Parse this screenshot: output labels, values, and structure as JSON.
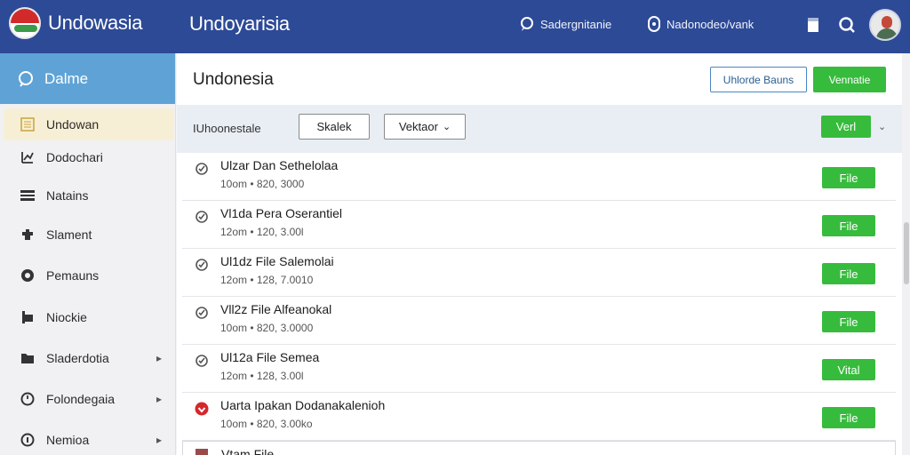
{
  "topbar": {
    "brand_name": "Undowasia",
    "app_title": "Undoyarisia",
    "item1": "Sadergnitanie",
    "item2": "Nadonodeo/vank"
  },
  "sidebar": {
    "header": "Dalme",
    "items": [
      {
        "label": "Undowan",
        "icon": "list-icon",
        "chevron": false
      },
      {
        "label": "Dodochari",
        "icon": "chart-icon",
        "chevron": false
      },
      {
        "label": "Natains",
        "icon": "menu-icon",
        "chevron": false
      },
      {
        "label": "Slament",
        "icon": "puzzle-icon",
        "chevron": false
      },
      {
        "label": "Pemauns",
        "icon": "circle-icon",
        "chevron": false
      },
      {
        "label": "Niockie",
        "icon": "pin-icon",
        "chevron": false
      },
      {
        "label": "Sladerdotia",
        "icon": "folder-icon",
        "chevron": true
      },
      {
        "label": "Folondegaia",
        "icon": "clock-icon",
        "chevron": true
      },
      {
        "label": "Nemioa",
        "icon": "info-icon",
        "chevron": true
      }
    ]
  },
  "main": {
    "title": "Undonesia",
    "btn_outline": "Uhlorde Bauns",
    "btn_primary": "Vennatie",
    "filter": {
      "label": "IUhoonestale",
      "btn1": "Skalek",
      "btn2": "Vektaor",
      "btn3": "Verl"
    },
    "rows": [
      {
        "name": "Ulzar Dan Sethelolaa",
        "meta": "10om • 820, 3000",
        "action": "File",
        "status": "ok"
      },
      {
        "name": "Vl1da Pera Oserantiel",
        "meta": "12om • 120, 3.00l",
        "action": "File",
        "status": "ok"
      },
      {
        "name": "Ul1dz File Salemolai",
        "meta": "12om • 128, 7.0010",
        "action": "File",
        "status": "ok"
      },
      {
        "name": "Vll2z File Alfeanokal",
        "meta": "10om • 820, 3.0000",
        "action": "File",
        "status": "ok"
      },
      {
        "name": "Ul12a File Semea",
        "meta": "12om • 128, 3.00l",
        "action": "Vital",
        "status": "ok"
      },
      {
        "name": "Uarta Ipakan Dodanakalenioh",
        "meta": "10om • 820, 3.00ko",
        "action": "File",
        "status": "alert"
      },
      {
        "name": "Vtam File",
        "meta": "",
        "action": "",
        "status": "partial"
      }
    ]
  },
  "colors": {
    "topbar": "#2d4a96",
    "sidebar_header": "#5fa3d6",
    "accent_green": "#37bb3d",
    "active_item": "#f7efd5"
  }
}
